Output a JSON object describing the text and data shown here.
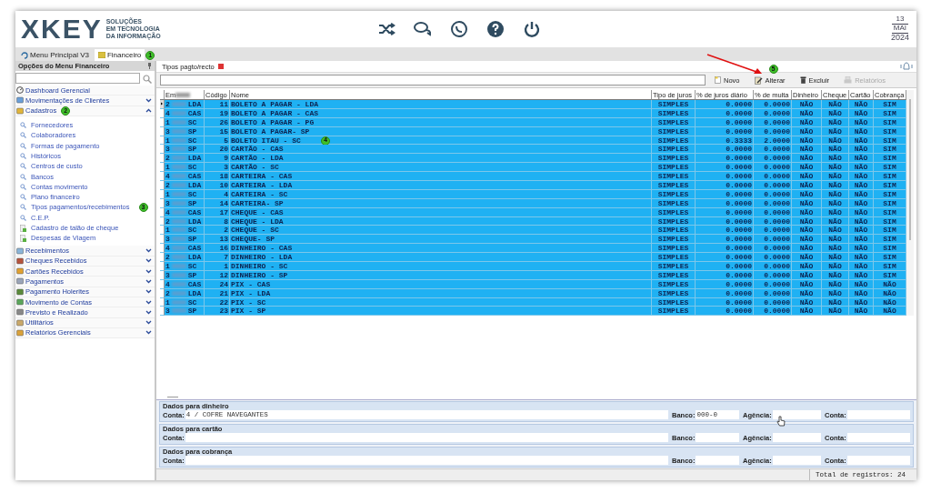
{
  "header": {
    "logo": "XKEY",
    "tagline": [
      "SOLUÇÕES",
      "EM TECNOLOGIA",
      "DA INFORMAÇÃO"
    ],
    "date": {
      "day": "13",
      "month": "MAI",
      "year": "2024"
    }
  },
  "module_tabs": [
    {
      "label": "Menu Principal V3",
      "selected": false
    },
    {
      "label": "Financeiro",
      "selected": true,
      "badge": "1"
    }
  ],
  "sidebar": {
    "title": "Opções do Menu Financeiro",
    "items": [
      {
        "kind": "link",
        "label": "Dashboard Gerencial"
      },
      {
        "kind": "section",
        "label": "Movimentações de Clientes",
        "expanded": false
      },
      {
        "kind": "section",
        "label": "Cadastros",
        "expanded": true,
        "badge": "2",
        "children": [
          {
            "kind": "search",
            "label": "Fornecedores"
          },
          {
            "kind": "search",
            "label": "Colaboradores"
          },
          {
            "kind": "search",
            "label": "Formas de pagamento"
          },
          {
            "kind": "search",
            "label": "Históricos"
          },
          {
            "kind": "search",
            "label": "Centros de custo"
          },
          {
            "kind": "search",
            "label": "Bancos"
          },
          {
            "kind": "search",
            "label": "Contas movimento"
          },
          {
            "kind": "search",
            "label": "Plano financeiro"
          },
          {
            "kind": "search",
            "label": "Tipos pagamentos/recebimentos",
            "badge": "3"
          },
          {
            "kind": "search",
            "label": "C.E.P."
          },
          {
            "kind": "form",
            "label": "Cadastro de talão de cheque"
          },
          {
            "kind": "form",
            "label": "Despesas de Viagem"
          }
        ]
      },
      {
        "kind": "section",
        "label": "Recebimentos",
        "expanded": false
      },
      {
        "kind": "section",
        "label": "Cheques Recebidos",
        "expanded": false
      },
      {
        "kind": "section",
        "label": "Cartões Recebidos",
        "expanded": false
      },
      {
        "kind": "section",
        "label": "Pagamentos",
        "expanded": false
      },
      {
        "kind": "section",
        "label": "Pagamento Holerites",
        "expanded": false
      },
      {
        "kind": "section",
        "label": "Movimento de Contas",
        "expanded": false
      },
      {
        "kind": "section",
        "label": "Previsto e Realizado",
        "expanded": false
      },
      {
        "kind": "section",
        "label": "Utilitários",
        "expanded": false
      },
      {
        "kind": "section",
        "label": "Relatórios Gerenciais",
        "expanded": false
      }
    ]
  },
  "doc_tab": {
    "label": "Tipos pagto/recto"
  },
  "toolbar": [
    {
      "label": "Novo",
      "kind": "new",
      "disabled": false
    },
    {
      "label": "Alterar",
      "kind": "edit",
      "disabled": false,
      "badge": "5"
    },
    {
      "label": "Excluir",
      "kind": "delete",
      "disabled": false
    },
    {
      "label": "Relatórios",
      "kind": "print",
      "disabled": true
    }
  ],
  "table": {
    "columns": [
      "Em",
      "Código",
      "Nome",
      "Tipo de juros",
      "% de juros diário",
      "% de multa",
      "Dinheiro",
      "Cheque",
      "Cartão",
      "Cobrança"
    ],
    "rows": [
      {
        "current": true,
        "selected": true,
        "empresa_code": "2",
        "empresa": "LDA",
        "codigo": "11",
        "nome": "BOLETO A PAGAR  - LDA",
        "tipo": "SIMPLES",
        "juros": "0.0000",
        "multa": "0.0000",
        "dinheiro": "NÃO",
        "cheque": "NÃO",
        "cartao": "NÃO",
        "cobranca": "SIM"
      },
      {
        "current": false,
        "selected": true,
        "empresa_code": "4",
        "empresa": "CAS",
        "codigo": "19",
        "nome": "BOLETO A PAGAR - CAS",
        "tipo": "SIMPLES",
        "juros": "0.0000",
        "multa": "0.0000",
        "dinheiro": "NÃO",
        "cheque": "NÃO",
        "cartao": "NÃO",
        "cobranca": "SIM"
      },
      {
        "current": false,
        "selected": true,
        "empresa_code": "1",
        "empresa": "SC",
        "codigo": "26",
        "nome": "BOLETO A PAGAR - PG",
        "tipo": "SIMPLES",
        "juros": "0.0000",
        "multa": "0.0000",
        "dinheiro": "NÃO",
        "cheque": "NÃO",
        "cartao": "NÃO",
        "cobranca": "SIM"
      },
      {
        "current": false,
        "selected": true,
        "empresa_code": "3",
        "empresa": "SP",
        "codigo": "15",
        "nome": "BOLETO A PAGAR- SP",
        "tipo": "SIMPLES",
        "juros": "0.0000",
        "multa": "0.0000",
        "dinheiro": "NÃO",
        "cheque": "NÃO",
        "cartao": "NÃO",
        "cobranca": "SIM"
      },
      {
        "current": false,
        "selected": true,
        "empresa_code": "1",
        "empresa": "SC",
        "codigo": "5",
        "nome": "BOLETO ITAU - SC",
        "badge": "4",
        "tipo": "SIMPLES",
        "juros": "0.3333",
        "multa": "2.0000",
        "dinheiro": "NÃO",
        "cheque": "NÃO",
        "cartao": "NÃO",
        "cobranca": "SIM"
      },
      {
        "current": false,
        "selected": true,
        "empresa_code": "3",
        "empresa": "SP",
        "codigo": "20",
        "nome": "CARTÃO - CAS",
        "tipo": "SIMPLES",
        "juros": "0.0000",
        "multa": "0.0000",
        "dinheiro": "NÃO",
        "cheque": "NÃO",
        "cartao": "NÃO",
        "cobranca": "SIM"
      },
      {
        "current": false,
        "selected": true,
        "empresa_code": "2",
        "empresa": "LDA",
        "codigo": "9",
        "nome": "CARTÃO - LDA",
        "tipo": "SIMPLES",
        "juros": "0.0000",
        "multa": "0.0000",
        "dinheiro": "NÃO",
        "cheque": "NÃO",
        "cartao": "NÃO",
        "cobranca": "SIM"
      },
      {
        "current": false,
        "selected": true,
        "empresa_code": "1",
        "empresa": "SC",
        "codigo": "3",
        "nome": "CARTÃO - SC",
        "tipo": "SIMPLES",
        "juros": "0.0000",
        "multa": "0.0000",
        "dinheiro": "NÃO",
        "cheque": "NÃO",
        "cartao": "NÃO",
        "cobranca": "SIM"
      },
      {
        "current": false,
        "selected": true,
        "empresa_code": "4",
        "empresa": "CAS",
        "codigo": "18",
        "nome": "CARTEIRA - CAS",
        "tipo": "SIMPLES",
        "juros": "0.0000",
        "multa": "0.0000",
        "dinheiro": "NÃO",
        "cheque": "NÃO",
        "cartao": "NÃO",
        "cobranca": "SIM"
      },
      {
        "current": false,
        "selected": true,
        "empresa_code": "2",
        "empresa": "LDA",
        "codigo": "10",
        "nome": "CARTEIRA - LDA",
        "tipo": "SIMPLES",
        "juros": "0.0000",
        "multa": "0.0000",
        "dinheiro": "NÃO",
        "cheque": "NÃO",
        "cartao": "NÃO",
        "cobranca": "SIM"
      },
      {
        "current": false,
        "selected": true,
        "empresa_code": "1",
        "empresa": "SC",
        "codigo": "4",
        "nome": "CARTEIRA - SC",
        "tipo": "SIMPLES",
        "juros": "0.0000",
        "multa": "0.0000",
        "dinheiro": "NÃO",
        "cheque": "NÃO",
        "cartao": "NÃO",
        "cobranca": "SIM"
      },
      {
        "current": false,
        "selected": true,
        "empresa_code": "3",
        "empresa": "SP",
        "codigo": "14",
        "nome": "CARTEIRA- SP",
        "tipo": "SIMPLES",
        "juros": "0.0000",
        "multa": "0.0000",
        "dinheiro": "NÃO",
        "cheque": "NÃO",
        "cartao": "NÃO",
        "cobranca": "SIM"
      },
      {
        "current": false,
        "selected": true,
        "empresa_code": "4",
        "empresa": "CAS",
        "codigo": "17",
        "nome": "CHEQUE - CAS",
        "tipo": "SIMPLES",
        "juros": "0.0000",
        "multa": "0.0000",
        "dinheiro": "NÃO",
        "cheque": "NÃO",
        "cartao": "NÃO",
        "cobranca": "SIM"
      },
      {
        "current": false,
        "selected": true,
        "empresa_code": "2",
        "empresa": "LDA",
        "codigo": "8",
        "nome": "CHEQUE - LDA",
        "tipo": "SIMPLES",
        "juros": "0.0000",
        "multa": "0.0000",
        "dinheiro": "NÃO",
        "cheque": "NÃO",
        "cartao": "NÃO",
        "cobranca": "SIM"
      },
      {
        "current": false,
        "selected": true,
        "empresa_code": "1",
        "empresa": "SC",
        "codigo": "2",
        "nome": "CHEQUE - SC",
        "tipo": "SIMPLES",
        "juros": "0.0000",
        "multa": "0.0000",
        "dinheiro": "NÃO",
        "cheque": "NÃO",
        "cartao": "NÃO",
        "cobranca": "SIM"
      },
      {
        "current": false,
        "selected": true,
        "empresa_code": "3",
        "empresa": "SP",
        "codigo": "13",
        "nome": "CHEQUE- SP",
        "tipo": "SIMPLES",
        "juros": "0.0000",
        "multa": "0.0000",
        "dinheiro": "NÃO",
        "cheque": "NÃO",
        "cartao": "NÃO",
        "cobranca": "SIM"
      },
      {
        "current": false,
        "selected": true,
        "empresa_code": "4",
        "empresa": "CAS",
        "codigo": "16",
        "nome": "DINHEIRO - CAS",
        "tipo": "SIMPLES",
        "juros": "0.0000",
        "multa": "0.0000",
        "dinheiro": "NÃO",
        "cheque": "NÃO",
        "cartao": "NÃO",
        "cobranca": "SIM"
      },
      {
        "current": false,
        "selected": true,
        "empresa_code": "2",
        "empresa": "LDA",
        "codigo": "7",
        "nome": "DINHEIRO - LDA",
        "tipo": "SIMPLES",
        "juros": "0.0000",
        "multa": "0.0000",
        "dinheiro": "NÃO",
        "cheque": "NÃO",
        "cartao": "NÃO",
        "cobranca": "SIM"
      },
      {
        "current": false,
        "selected": true,
        "empresa_code": "1",
        "empresa": "SC",
        "codigo": "1",
        "nome": "DINHEIRO - SC",
        "tipo": "SIMPLES",
        "juros": "0.0000",
        "multa": "0.0000",
        "dinheiro": "NÃO",
        "cheque": "NÃO",
        "cartao": "NÃO",
        "cobranca": "SIM"
      },
      {
        "current": false,
        "selected": true,
        "empresa_code": "3",
        "empresa": "SP",
        "codigo": "12",
        "nome": "DINHEIRO - SP",
        "tipo": "SIMPLES",
        "juros": "0.0000",
        "multa": "0.0000",
        "dinheiro": "NÃO",
        "cheque": "NÃO",
        "cartao": "NÃO",
        "cobranca": "SIM"
      },
      {
        "current": false,
        "selected": true,
        "empresa_code": "4",
        "empresa": "CAS",
        "codigo": "24",
        "nome": "PIX - CAS",
        "tipo": "SIMPLES",
        "juros": "0.0000",
        "multa": "0.0000",
        "dinheiro": "NÃO",
        "cheque": "NÃO",
        "cartao": "NÃO",
        "cobranca": "NÃO"
      },
      {
        "current": false,
        "selected": true,
        "empresa_code": "2",
        "empresa": "LDA",
        "codigo": "21",
        "nome": "PIX - LDA",
        "tipo": "SIMPLES",
        "juros": "0.0000",
        "multa": "0.0000",
        "dinheiro": "NÃO",
        "cheque": "NÃO",
        "cartao": "NÃO",
        "cobranca": "NÃO"
      },
      {
        "current": false,
        "selected": true,
        "empresa_code": "1",
        "empresa": "SC",
        "codigo": "22",
        "nome": "PIX - SC",
        "tipo": "SIMPLES",
        "juros": "0.0000",
        "multa": "0.0000",
        "dinheiro": "NÃO",
        "cheque": "NÃO",
        "cartao": "NÃO",
        "cobranca": "NÃO"
      },
      {
        "current": false,
        "selected": true,
        "empresa_code": "3",
        "empresa": "SP",
        "codigo": "23",
        "nome": "PIX - SP",
        "tipo": "SIMPLES",
        "juros": "0.0000",
        "multa": "0.0000",
        "dinheiro": "NÃO",
        "cheque": "NÃO",
        "cartao": "NÃO",
        "cobranca": "NÃO"
      }
    ]
  },
  "detail_groups": [
    {
      "title": "Dados para dinheiro",
      "fields": [
        {
          "label": "Conta:",
          "value": "4 / COFRE NAVEGANTES"
        },
        {
          "label": "Banco:",
          "value": "000-0"
        },
        {
          "label": "Agência:"
        },
        {
          "label": "Conta:"
        }
      ]
    },
    {
      "title": "Dados para cartão",
      "fields": [
        {
          "label": "Conta:"
        },
        {
          "label": "Banco:"
        },
        {
          "label": "Agência:"
        },
        {
          "label": "Conta:"
        }
      ]
    },
    {
      "title": "Dados para cobrança",
      "fields": [
        {
          "label": "Conta:"
        },
        {
          "label": "Banco:"
        },
        {
          "label": "Agência:"
        },
        {
          "label": "Conta:"
        }
      ]
    }
  ],
  "status_bar": {
    "total": "Total de registros: 24"
  }
}
